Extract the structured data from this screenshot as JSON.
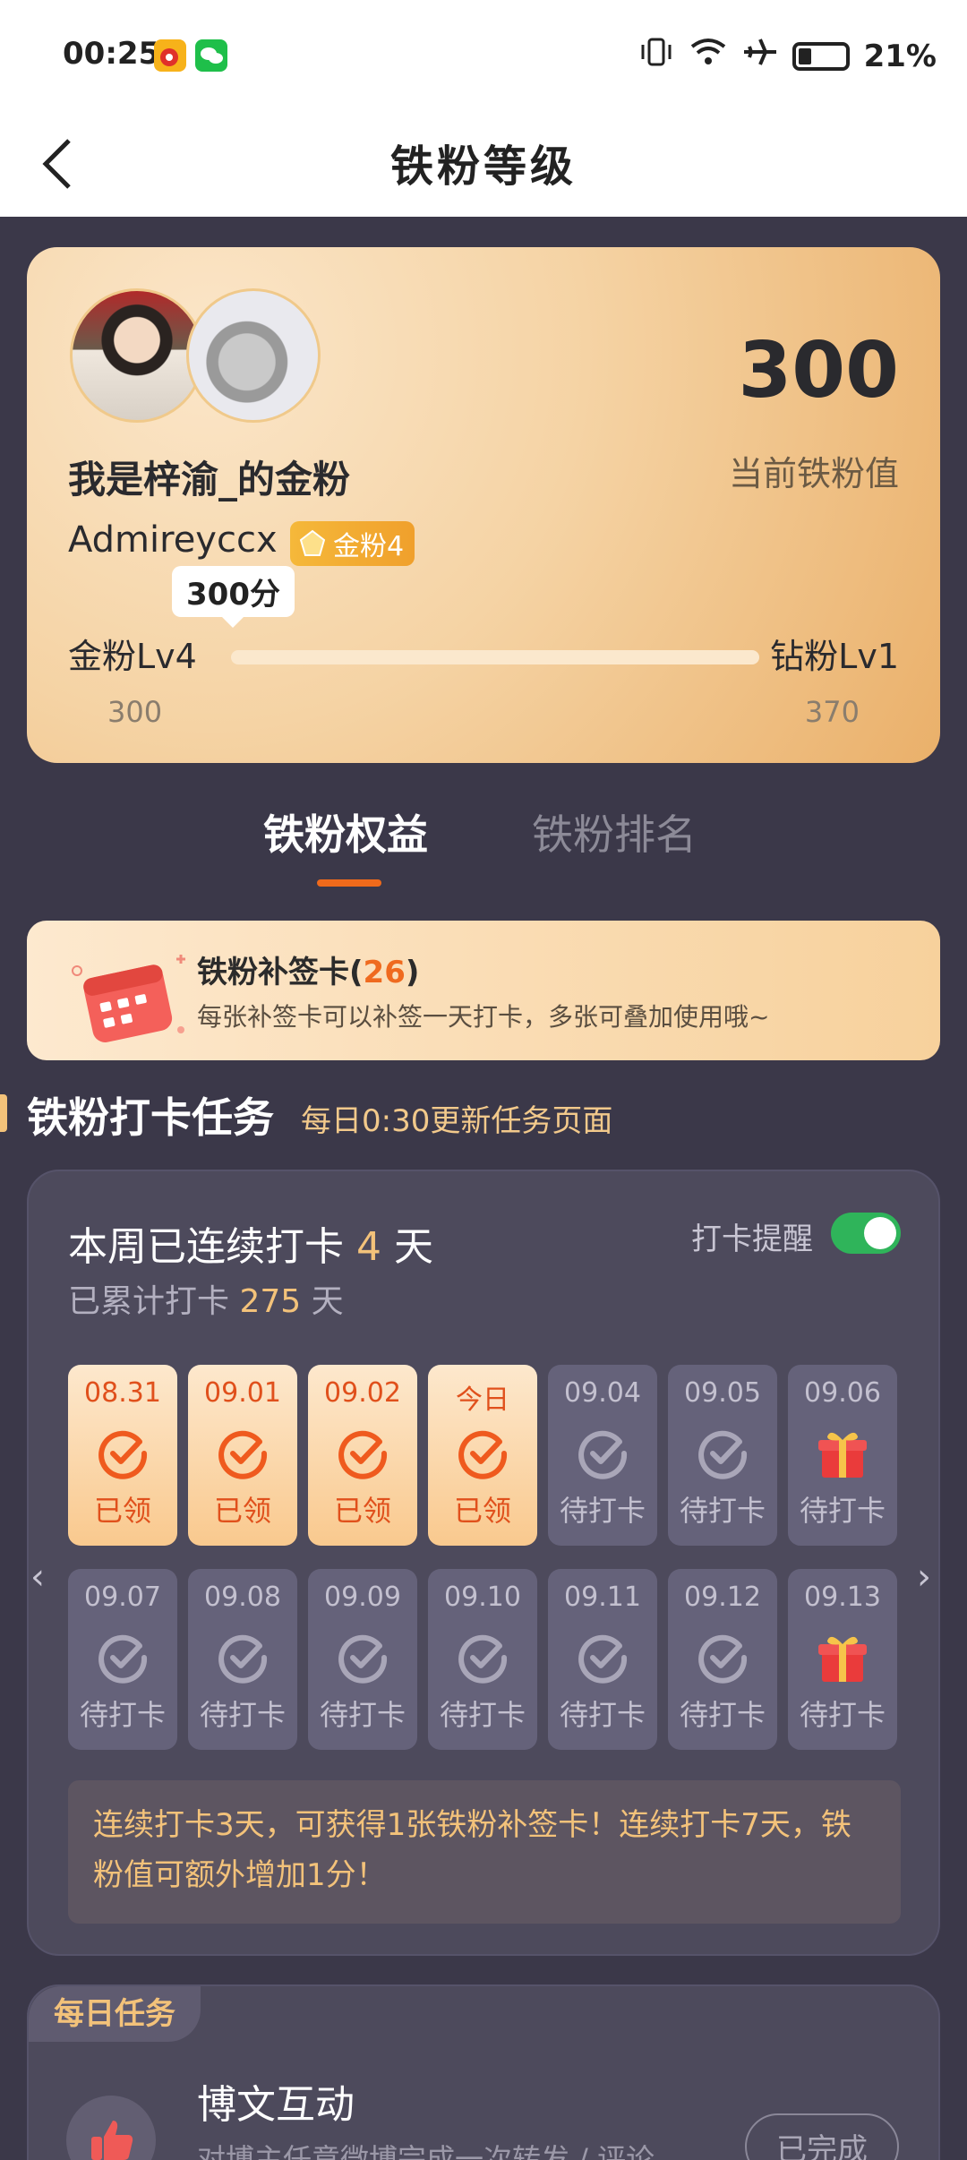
{
  "status_bar": {
    "time": "00:25",
    "battery": "21%",
    "icons": [
      "weibo-app-icon",
      "wechat-app-icon",
      "vibrate-icon",
      "wifi-icon",
      "airplane-icon",
      "battery-icon"
    ]
  },
  "header": {
    "title": "铁粉等级",
    "back_icon": "chevron-left-icon"
  },
  "level_card": {
    "score": "300",
    "score_label": "当前铁粉值",
    "fan_name": "我是梓渝_的金粉",
    "username": "Admireyccx",
    "badge": "金粉4",
    "tooltip": "300分",
    "level_current": "金粉Lv4",
    "level_next": "钻粉Lv1",
    "level_current_value": "300",
    "level_next_value": "370",
    "progress_fraction": 0.0
  },
  "tabs": [
    {
      "label": "铁粉权益",
      "active": true
    },
    {
      "label": "铁粉排名",
      "active": false
    }
  ],
  "makeup_card": {
    "title": "铁粉补签卡",
    "count_open": "(",
    "count": "26",
    "count_close": ")",
    "description": "每张补签卡可以补签一天打卡，多张可叠加使用哦~"
  },
  "checkin_section": {
    "title": "铁粉打卡任务",
    "subtitle": "每日0:30更新任务页面"
  },
  "checkin_card": {
    "streak_prefix": "本周已连续打卡 ",
    "streak_days": "4",
    "streak_suffix": " 天",
    "total_prefix": "已累计打卡 ",
    "total_days": "275",
    "total_suffix": " 天",
    "reminder_label": "打卡提醒",
    "reminder_on": true,
    "days_row1": [
      {
        "date": "08.31",
        "status": "已领",
        "done": true,
        "gift": false
      },
      {
        "date": "09.01",
        "status": "已领",
        "done": true,
        "gift": false
      },
      {
        "date": "09.02",
        "status": "已领",
        "done": true,
        "gift": false
      },
      {
        "date": "今日",
        "status": "已领",
        "done": true,
        "gift": false
      },
      {
        "date": "09.04",
        "status": "待打卡",
        "done": false,
        "gift": false
      },
      {
        "date": "09.05",
        "status": "待打卡",
        "done": false,
        "gift": false
      },
      {
        "date": "09.06",
        "status": "待打卡",
        "done": false,
        "gift": true
      }
    ],
    "days_row2": [
      {
        "date": "09.07",
        "status": "待打卡",
        "done": false,
        "gift": false
      },
      {
        "date": "09.08",
        "status": "待打卡",
        "done": false,
        "gift": false
      },
      {
        "date": "09.09",
        "status": "待打卡",
        "done": false,
        "gift": false
      },
      {
        "date": "09.10",
        "status": "待打卡",
        "done": false,
        "gift": false
      },
      {
        "date": "09.11",
        "status": "待打卡",
        "done": false,
        "gift": false
      },
      {
        "date": "09.12",
        "status": "待打卡",
        "done": false,
        "gift": false
      },
      {
        "date": "09.13",
        "status": "待打卡",
        "done": false,
        "gift": true
      }
    ],
    "reward_text": "连续打卡3天，可获得1张铁粉补签卡！连续打卡7天，铁粉值可额外增加1分！"
  },
  "daily_tasks": {
    "tag": "每日任务",
    "task_title": "博文互动",
    "task_desc": "对博主任意微博完成一次转发 / 评论",
    "task_button": "已完成"
  },
  "colors": {
    "background": "#3b3849",
    "accent_orange": "#f06a1b",
    "gold_text": "#f3c27a",
    "toggle_on": "#2fb45a"
  }
}
